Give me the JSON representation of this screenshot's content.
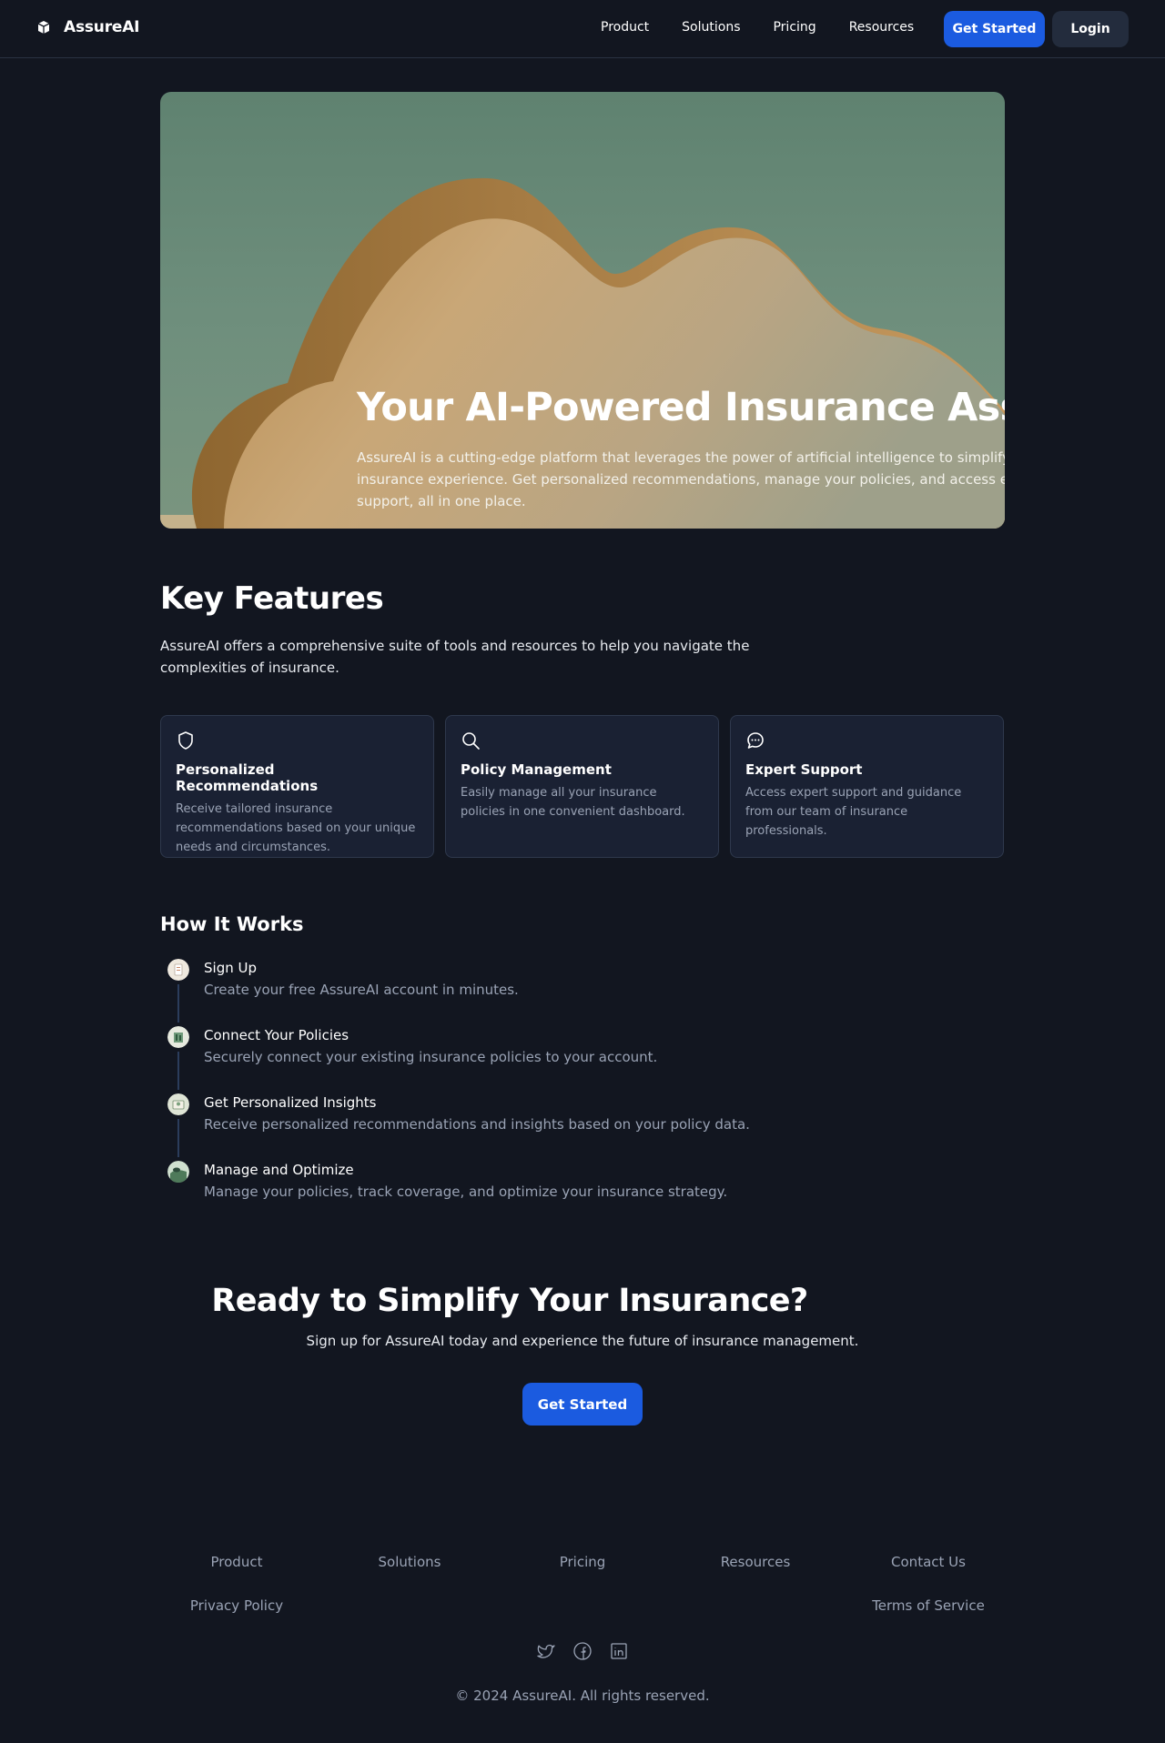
{
  "brand": {
    "name": "AssureAI",
    "icon": "cube-icon"
  },
  "nav": {
    "items": [
      "Product",
      "Solutions",
      "Pricing",
      "Resources"
    ]
  },
  "header": {
    "get_started": "Get Started",
    "login": "Login"
  },
  "hero": {
    "title": "Your AI-Powered Insurance Assistant",
    "text": "AssureAI is a cutting-edge platform that leverages the power of artificial intelligence to simplify your insurance experience. Get personalized recommendations, manage your policies, and access expert support, all in one place."
  },
  "features": {
    "title": "Key Features",
    "intro": "AssureAI offers a comprehensive suite of tools and resources to help you navigate the complexities of insurance.",
    "cards": [
      {
        "icon": "shield-icon",
        "title": "Personalized Recommendations",
        "text": "Receive tailored insurance recommendations based on your unique needs and circumstances."
      },
      {
        "icon": "search-icon",
        "title": "Policy Management",
        "text": "Easily manage all your insurance policies in one convenient dashboard."
      },
      {
        "icon": "chat-icon",
        "title": "Expert Support",
        "text": "Access expert support and guidance from our team of insurance professionals."
      }
    ]
  },
  "how_it_works": {
    "title": "How It Works",
    "steps": [
      {
        "title": "Sign Up",
        "text": "Create your free AssureAI account in minutes."
      },
      {
        "title": "Connect Your Policies",
        "text": "Securely connect your existing insurance policies to your account."
      },
      {
        "title": "Get Personalized Insights",
        "text": "Receive personalized recommendations and insights based on your policy data."
      },
      {
        "title": "Manage and Optimize",
        "text": "Manage your policies, track coverage, and optimize your insurance strategy."
      }
    ]
  },
  "cta": {
    "title": "Ready to Simplify Your Insurance?",
    "text": "Sign up for AssureAI today and experience the future of insurance management.",
    "button": "Get Started"
  },
  "footer": {
    "row1": [
      "Product",
      "Solutions",
      "Pricing",
      "Resources",
      "Contact Us"
    ],
    "row2": [
      "Privacy Policy",
      "Terms of Service"
    ],
    "socials": [
      "twitter-icon",
      "facebook-icon",
      "linkedin-icon"
    ],
    "copyright": "© 2024 AssureAI. All rights reserved."
  },
  "colors": {
    "background": "#121620",
    "accent": "#1b5be0",
    "card": "#1a2133",
    "muted_text": "#9aa3b5"
  }
}
